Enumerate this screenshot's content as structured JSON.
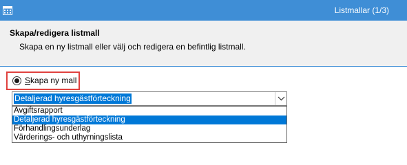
{
  "window": {
    "title": "Listmallar (1/3)",
    "accent_color": "#3f8ed6"
  },
  "header": {
    "heading": "Skapa/redigera listmall",
    "description": "Skapa en ny listmall eller välj och redigera en befintlig listmall."
  },
  "radio_new": {
    "label_mnemonic": "S",
    "label_rest": "kapa ny mall",
    "checked": true,
    "highlight_color": "#e0413e"
  },
  "combo": {
    "value": "Detaljerad hyresgästförteckning",
    "arrow_icon": "chevron-down-icon"
  },
  "dropdown": {
    "options": [
      "Avgiftsrapport",
      "Detaljerad hyresgästförteckning",
      "Förhandlingsunderlag",
      "Värderings- och uthyrningslista"
    ],
    "selected_index": 1
  }
}
